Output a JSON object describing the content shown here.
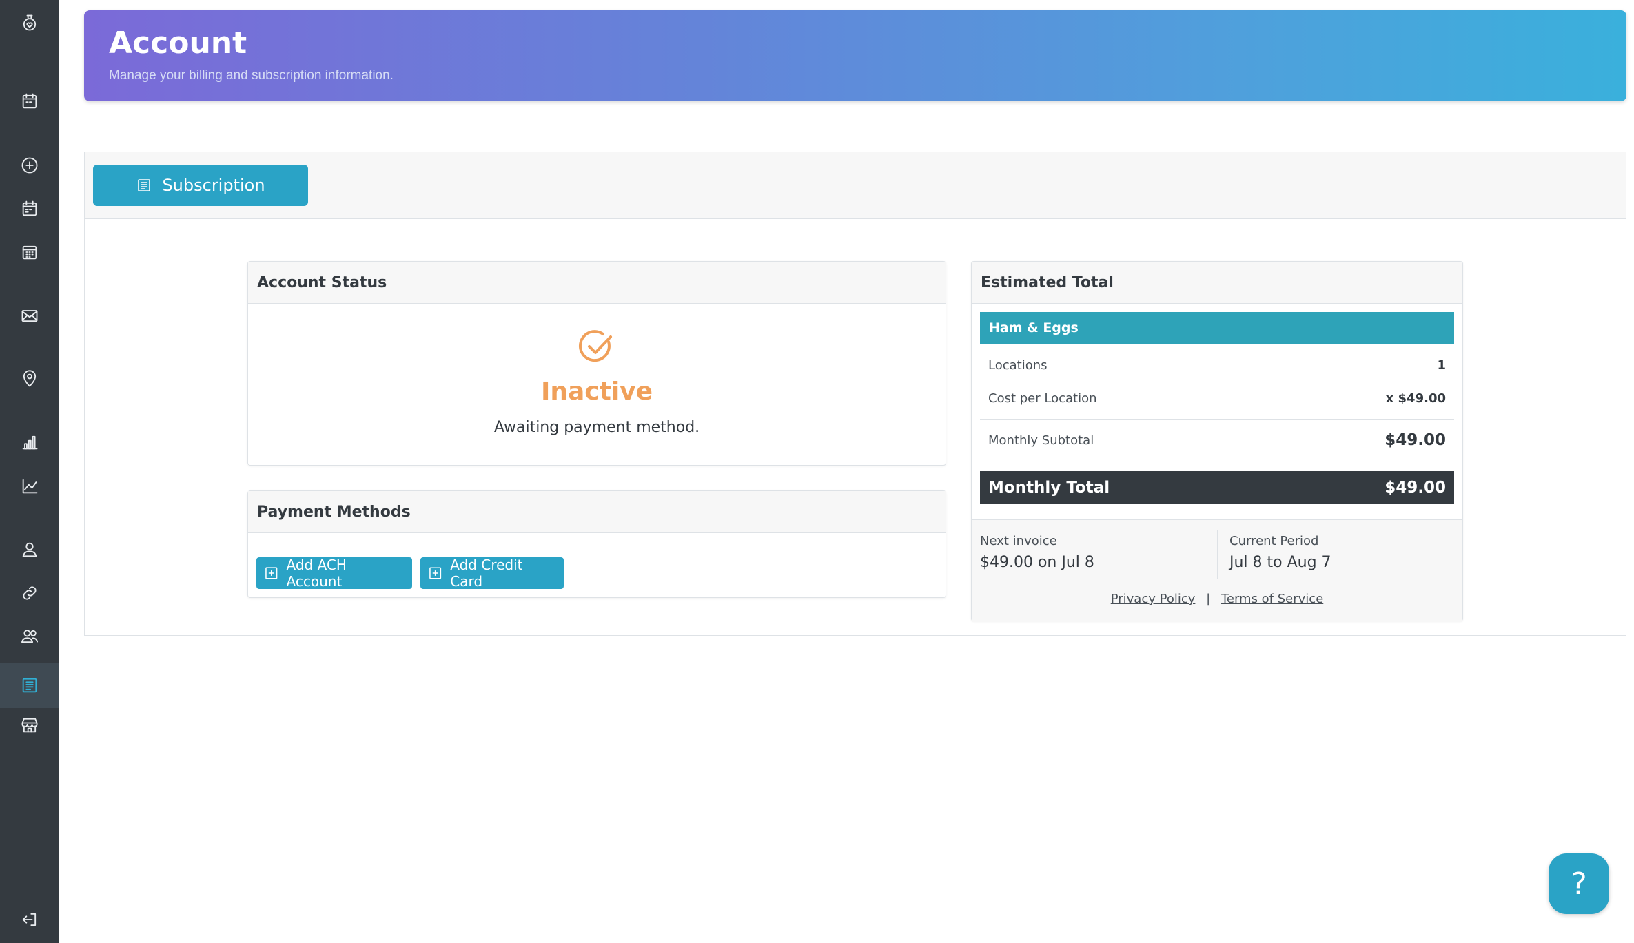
{
  "sidebar": {
    "items": [
      {
        "name": "calendar-icon"
      },
      {
        "name": "add-icon"
      },
      {
        "name": "calendar-events-icon"
      },
      {
        "name": "calendar-grid-icon"
      },
      {
        "name": "mail-icon"
      },
      {
        "name": "location-pin-icon"
      },
      {
        "name": "bar-chart-icon"
      },
      {
        "name": "line-chart-icon"
      },
      {
        "name": "user-icon"
      },
      {
        "name": "link-icon"
      },
      {
        "name": "users-icon"
      },
      {
        "name": "billing-icon",
        "active": true
      },
      {
        "name": "store-icon"
      }
    ],
    "logout": {
      "name": "logout-icon"
    }
  },
  "header": {
    "title": "Account",
    "subtitle": "Manage your billing and subscription information."
  },
  "tabs": {
    "subscription_label": "Subscription"
  },
  "account_status": {
    "heading": "Account Status",
    "status": "Inactive",
    "message": "Awaiting payment method.",
    "status_color": "#f0a05a"
  },
  "payment_methods": {
    "heading": "Payment Methods",
    "add_ach_label": "Add ACH Account",
    "add_card_label": "Add Credit Card"
  },
  "estimated_total": {
    "heading": "Estimated Total",
    "plan_name": "Ham & Eggs",
    "rows": [
      {
        "label": "Locations",
        "value": "1"
      },
      {
        "label": "Cost per Location",
        "value": "x $49.00"
      }
    ],
    "subtotal": {
      "label": "Monthly Subtotal",
      "value": "$49.00"
    },
    "total": {
      "label": "Monthly Total",
      "value": "$49.00"
    },
    "next_invoice": {
      "label": "Next invoice",
      "value": "$49.00 on Jul 8"
    },
    "current_period": {
      "label": "Current Period",
      "value": "Jul 8 to Aug 7"
    },
    "privacy_label": "Privacy Policy",
    "separator": "|",
    "terms_label": "Terms of Service"
  },
  "help": {
    "label": "?"
  },
  "colors": {
    "accent": "#2aa3c6",
    "sidebar": "#343a40",
    "plan_bar": "#2ea3b8",
    "warning": "#f0a05a"
  }
}
